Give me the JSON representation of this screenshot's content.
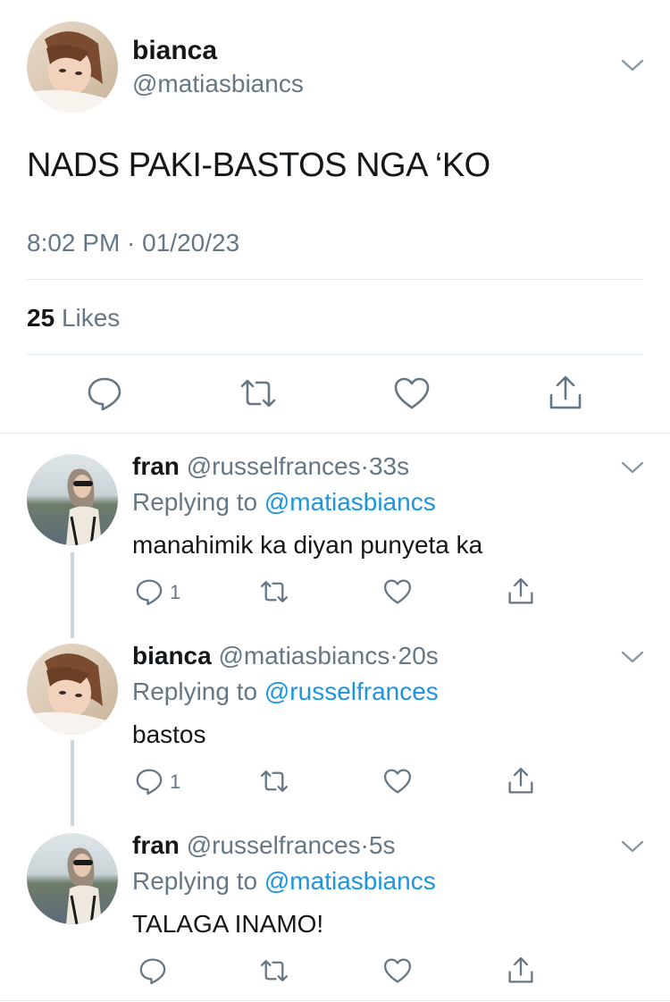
{
  "main_tweet": {
    "name": "bianca",
    "handle": "@matiasbiancs",
    "text": "NADS PAKI-BASTOS NGA ‘KO",
    "timestamp": "8:02 PM · 01/20/23",
    "likes_count": "25",
    "likes_label": "Likes",
    "actions": [
      "reply-icon",
      "retweet-icon",
      "like-icon",
      "share-icon"
    ]
  },
  "replies": [
    {
      "name": "fran",
      "handle": "@russelfrances",
      "dot": "·",
      "time": "33s",
      "replying_prefix": "Replying to",
      "replying_to": "@matiasbiancs",
      "text": "manahimik ka diyan punyeta ka",
      "reply_count": "1"
    },
    {
      "name": "bianca",
      "handle": "@matiasbiancs",
      "dot": "·",
      "time": "20s",
      "replying_prefix": "Replying to",
      "replying_to": "@russelfrances",
      "text": "bastos",
      "reply_count": "1"
    },
    {
      "name": "fran",
      "handle": "@russelfrances",
      "dot": "·",
      "time": "5s",
      "replying_prefix": "Replying to",
      "replying_to": "@matiasbiancs",
      "text": "TALAGA INAMO!",
      "reply_count": ""
    }
  ],
  "colors": {
    "text": "#14171a",
    "secondary": "#657786",
    "link": "#1b95e0",
    "divider": "#e1e8ed",
    "thread_line": "#ccd6dd"
  }
}
